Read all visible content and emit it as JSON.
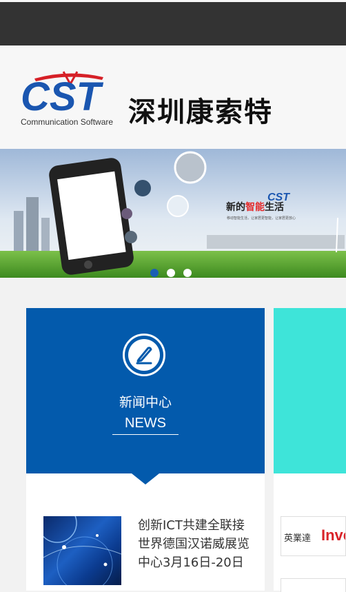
{
  "header": {
    "logo_text": "CST",
    "logo_subtitle": "Communication Software",
    "company_name": "深圳康索特"
  },
  "banner": {
    "logo_text": "CST",
    "headline_part1": "新的",
    "headline_highlight": "智能",
    "headline_part2": "生活",
    "tagline": "移动智能生活，让家居更智能，让家居更放心",
    "slides": 3,
    "active_slide": 1,
    "colors": {
      "accent": "#e52a2a",
      "active_dot": "#1a5fb4"
    }
  },
  "news": {
    "title": "新闻中心",
    "subtitle": "NEWS",
    "item": {
      "text": "创新ICT共建全联接世界德国汉诺威展览中心3月16日-20日"
    },
    "colors": {
      "header_bg": "#035aac"
    }
  },
  "partners": {
    "items": [
      {
        "name_cn": "英業達",
        "name_en": "Inventec"
      }
    ],
    "colors": {
      "header_bg": "#3ee4d9"
    }
  }
}
